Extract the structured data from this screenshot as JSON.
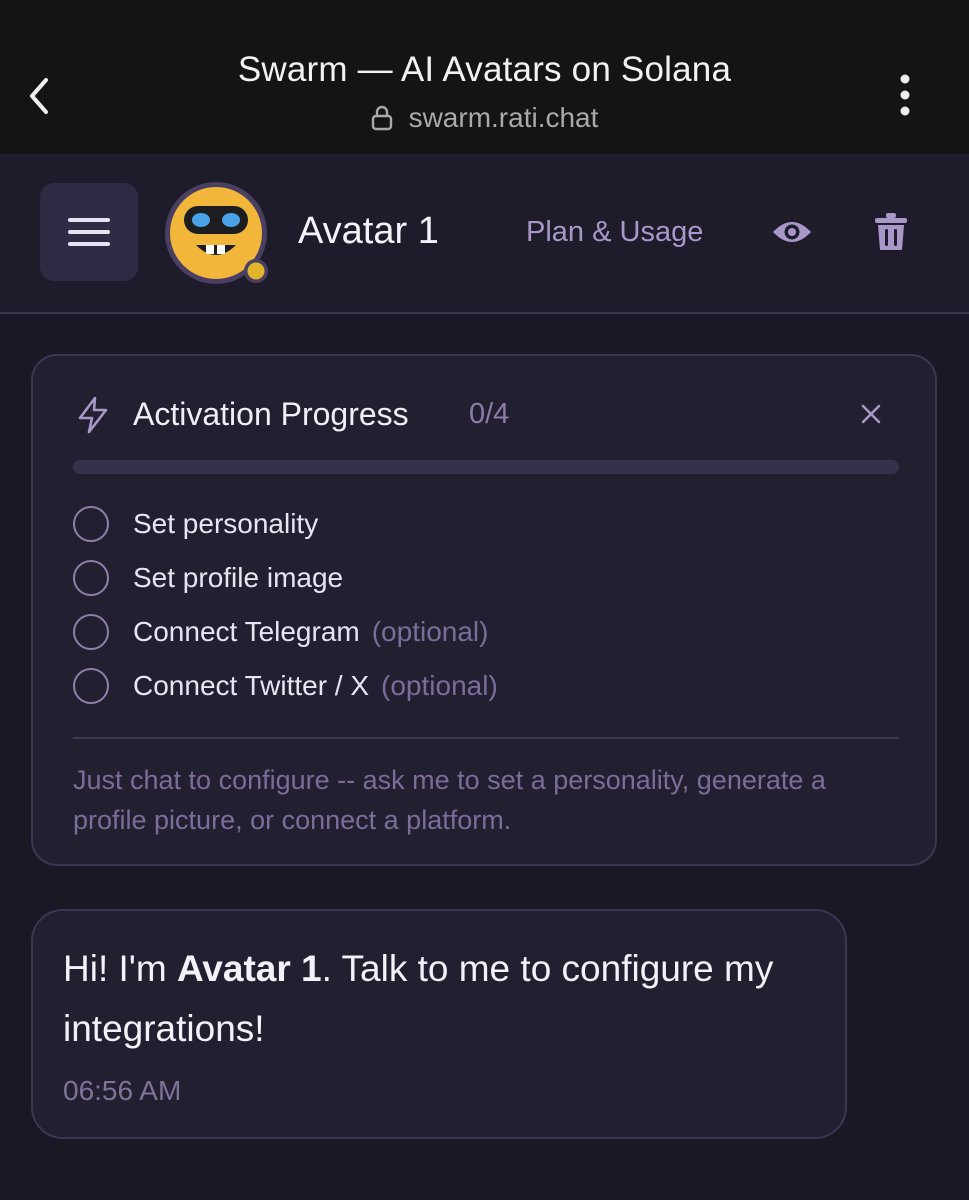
{
  "browser": {
    "title": "Swarm — AI Avatars on Solana",
    "url": "swarm.rati.chat"
  },
  "header": {
    "avatar_name": "Avatar 1",
    "plan_link": "Plan & Usage",
    "status_color": "#e0b52c"
  },
  "activation": {
    "title": "Activation Progress",
    "count": "0/4",
    "progress": 0,
    "tasks": [
      {
        "label": "Set personality",
        "optional": ""
      },
      {
        "label": "Set profile image",
        "optional": ""
      },
      {
        "label": "Connect Telegram",
        "optional": "(optional)"
      },
      {
        "label": "Connect Twitter / X",
        "optional": "(optional)"
      }
    ],
    "hint": "Just chat to configure -- ask me to set a personality, generate a profile picture, or connect a platform."
  },
  "message": {
    "prefix": "Hi! I'm ",
    "bold": "Avatar 1",
    "suffix": ". Talk to me to configure my integrations!",
    "time": "06:56 AM"
  },
  "colors": {
    "accent": "#a897c7",
    "background": "#1a1825",
    "card": "#221f30"
  }
}
